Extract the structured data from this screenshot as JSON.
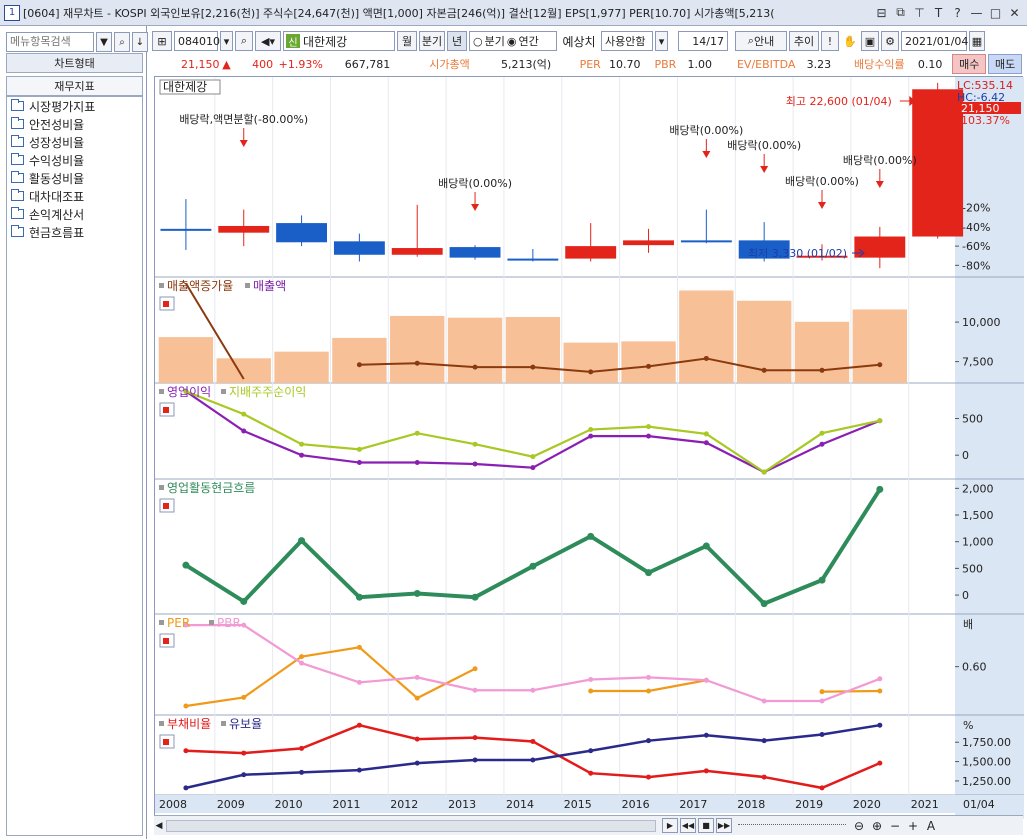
{
  "window": {
    "number": "1",
    "title": "[0604] 재무차트 - KOSPI 외국인보유[2,216(천)] 주식수[24,647(천)] 액면[1,000] 자본금[246(억)] 결산[12월] EPS[1,977] PER[10.70] 시가총액[5,213(",
    "icons": [
      "window-list-icon",
      "restore-icon",
      "pin-icon",
      "font-icon",
      "help-icon",
      "minimize-icon",
      "maximize-icon",
      "close-icon"
    ],
    "icon_glyphs": [
      "⊟",
      "⧉",
      "⊤",
      "T",
      "?",
      "—",
      "□",
      "✕"
    ]
  },
  "left_panel": {
    "search_placeholder": "메뉴항목검색",
    "chart_type_button": "차트형태",
    "financial_indicators_button": "재무지표",
    "items": [
      "시장평가지표",
      "안전성비율",
      "성장성비율",
      "수익성비율",
      "활동성비율",
      "대차대조표",
      "손익계산서",
      "현금흐름표"
    ]
  },
  "toolbar": {
    "code": "084010",
    "name_badge": "신",
    "name": "대한제강",
    "month": "월",
    "quarter": "분기",
    "year": "년",
    "radio_quarter": "분기",
    "radio_annual": "연간",
    "estimate_label": "예상치",
    "estimate_value": "사용안함",
    "page": "14/17",
    "guide": "안내",
    "trend": "추이",
    "date": "2021/01/04"
  },
  "info": {
    "price": "21,150",
    "change": "400",
    "pct": "+1.93%",
    "volume": "667,781",
    "mcap_label": "시가총액",
    "mcap_value": "5,213(억)",
    "per_label": "PER",
    "per_value": "10.70",
    "pbr_label": "PBR",
    "pbr_value": "1.00",
    "ev_label": "EV/EBITDA",
    "ev_value": "3.23",
    "div_label": "배당수익률",
    "div_value": "0.10",
    "buy": "매수",
    "sell": "매도"
  },
  "chart_data": [
    {
      "type": "candlestick",
      "title": "대한제강",
      "x": [
        "2008",
        "2009",
        "2010",
        "2011",
        "2012",
        "2013",
        "2014",
        "2015",
        "2016",
        "2017",
        "2018",
        "2019",
        "2020",
        "2021"
      ],
      "open": [
        -42.0,
        -39.0,
        -36.0,
        -55.0,
        -62.0,
        -61.0,
        -73.0,
        -73.0,
        -54.0,
        -54.0,
        -54.0,
        -70.0,
        -72.0,
        -50.0
      ],
      "close": [
        -42.0,
        -46.0,
        -56.0,
        -69.0,
        -69.0,
        -72.0,
        -73.0,
        -60.0,
        -59.0,
        -54.0,
        -73.0,
        -72.0,
        -50.0,
        103.37
      ],
      "high": [
        -11.0,
        -22.0,
        -28.0,
        -47.0,
        -17.0,
        -59.0,
        -63.0,
        -36.0,
        -42.0,
        -22.0,
        -35.0,
        -58.0,
        -40.0,
        110.0
      ],
      "low": [
        -64.0,
        -60.0,
        -60.0,
        -76.0,
        -71.0,
        -74.0,
        -76.0,
        -76.0,
        -67.0,
        -57.0,
        -76.0,
        -75.0,
        -83.0,
        -52.0
      ],
      "up": [
        false,
        true,
        false,
        false,
        true,
        false,
        false,
        true,
        true,
        false,
        false,
        true,
        true,
        true
      ],
      "y_ticks": [
        "-20%",
        "-40%",
        "-60%",
        "-80%"
      ],
      "y_tick_values": [
        -20,
        -40,
        -60,
        -80
      ],
      "ylim": [
        -88,
        112
      ],
      "lc": "LC:535.14",
      "hc": "HC:-6.42",
      "last_price": "21,150",
      "last_pct": "103.37%",
      "annotations": [
        {
          "text": "배당락,액면분할(-80.00%)",
          "year": "2009"
        },
        {
          "text": "배당락(0.00%)",
          "year": "2013"
        },
        {
          "text": "배당락(0.00%)",
          "year": "2017"
        },
        {
          "text": "배당락(0.00%)",
          "year": "2018"
        },
        {
          "text": "배당락(0.00%)",
          "year": "2019"
        },
        {
          "text": "배당락(0.00%)",
          "year": "2020"
        }
      ],
      "high_label": "최고 22,600 (01/04)",
      "low_label": "최저 3,330 (01/02)"
    },
    {
      "type": "bar",
      "series": [
        {
          "name": "매출액증가율",
          "values": [
            12450,
            6400,
            null,
            7300,
            7400,
            7150,
            7150,
            6850,
            7200,
            7700,
            6950,
            6950,
            7300
          ]
        },
        {
          "name": "매출액",
          "values": [
            9050,
            7710,
            8130,
            9000,
            10390,
            10280,
            10320,
            8700,
            8780,
            12000,
            11350,
            10020,
            10800
          ]
        }
      ],
      "categories": [
        "2008",
        "2009",
        "2010",
        "2011",
        "2012",
        "2013",
        "2014",
        "2015",
        "2016",
        "2017",
        "2018",
        "2019",
        "2020"
      ],
      "y_ticks": [
        "10,000",
        "7,500"
      ],
      "y_tick_values": [
        10000,
        7500
      ],
      "ylim": [
        6400,
        12600
      ]
    },
    {
      "type": "line",
      "categories": [
        "2008",
        "2009",
        "2010",
        "2011",
        "2012",
        "2013",
        "2014",
        "2015",
        "2016",
        "2017",
        "2018",
        "2019",
        "2020"
      ],
      "series": [
        {
          "name": "영업이익",
          "values": [
            870,
            330,
            0,
            -100,
            -100,
            -120,
            -170,
            260,
            260,
            170,
            -230,
            150,
            470
          ]
        },
        {
          "name": "지배주주순이익",
          "values": [
            870,
            560,
            150,
            80,
            300,
            150,
            -20,
            350,
            390,
            290,
            -230,
            300,
            470
          ]
        }
      ],
      "y_ticks": [
        "500",
        "0"
      ],
      "y_tick_values": [
        500,
        0
      ],
      "ylim": [
        -270,
        930
      ]
    },
    {
      "type": "line",
      "categories": [
        "2008",
        "2009",
        "2010",
        "2011",
        "2012",
        "2013",
        "2014",
        "2015",
        "2016",
        "2017",
        "2018",
        "2019",
        "2020"
      ],
      "series": [
        {
          "name": "영업활동현금흐름",
          "values": [
            560,
            -120,
            1020,
            -40,
            30,
            -40,
            540,
            1100,
            420,
            920,
            -160,
            280,
            1980
          ]
        }
      ],
      "y_ticks": [
        "2,000",
        "1,500",
        "1,000",
        "500",
        "0"
      ],
      "y_tick_values": [
        2000,
        1500,
        1000,
        500,
        0
      ],
      "ylim": [
        -280,
        2100
      ]
    },
    {
      "type": "line",
      "categories": [
        "2008",
        "2009",
        "2010",
        "2011",
        "2012",
        "2013",
        "2014",
        "2015",
        "2016",
        "2017",
        "2018",
        "2019",
        "2020"
      ],
      "series": [
        {
          "name": "PER",
          "values": [
            0.05,
            0.17,
            0.74,
            0.87,
            0.16,
            0.57,
            null,
            0.26,
            0.26,
            0.41,
            null,
            0.25,
            0.26
          ]
        },
        {
          "name": "PBR",
          "values": [
            1.18,
            1.18,
            0.65,
            0.38,
            0.45,
            0.27,
            0.27,
            0.42,
            0.45,
            0.41,
            0.12,
            0.12,
            0.43
          ]
        }
      ],
      "y_unit": "배",
      "y_ticks": [
        "0.60"
      ],
      "y_tick_values": [
        0.6
      ],
      "ylim": [
        -0.02,
        1.28
      ]
    },
    {
      "type": "line",
      "categories": [
        "2008",
        "2009",
        "2010",
        "2011",
        "2012",
        "2013",
        "2014",
        "2015",
        "2016",
        "2017",
        "2018",
        "2019",
        "2020"
      ],
      "series": [
        {
          "name": "부채비율",
          "values": [
            1640,
            1610,
            1670,
            1970,
            1790,
            1810,
            1760,
            1350,
            1300,
            1380,
            1300,
            1160,
            1480
          ]
        },
        {
          "name": "유보율",
          "values": [
            1160,
            1330,
            1360,
            1390,
            1480,
            1520,
            1520,
            1640,
            1770,
            1840,
            1770,
            1850,
            1970
          ]
        }
      ],
      "y_unit": "%",
      "y_ticks": [
        "1,750.00",
        "1,500.00",
        "1,250.00"
      ],
      "y_tick_values": [
        1750,
        1500,
        1250
      ],
      "ylim": [
        1120,
        2050
      ]
    }
  ],
  "x_axis": {
    "years": [
      "2008",
      "2009",
      "2010",
      "2011",
      "2012",
      "2013",
      "2014",
      "2015",
      "2016",
      "2017",
      "2018",
      "2019",
      "2020",
      "2021"
    ],
    "end_label": "01/04"
  },
  "colors": {
    "up": "#e3241b",
    "down": "#1a5fc8",
    "bar": "#f7c097",
    "growth": "#8b3a0f",
    "op": "#8a1fb3",
    "net": "#a8c823",
    "cf": "#2e8b5a",
    "per": "#f09a1a",
    "pbr": "#f29ad4",
    "debt": "#e31b1b",
    "reserve": "#2a2a8a",
    "accent": "#1a3fa8"
  },
  "nav": {
    "buttons": [
      "▶",
      "◀◀",
      "■",
      "▶▶"
    ],
    "zoom_icons": [
      "search-minus-icon",
      "search-plus-icon",
      "minus-icon",
      "plus-icon",
      "font-icon"
    ],
    "zoom_glyphs": [
      "⊖",
      "⊕",
      "−",
      "+",
      "A"
    ]
  }
}
